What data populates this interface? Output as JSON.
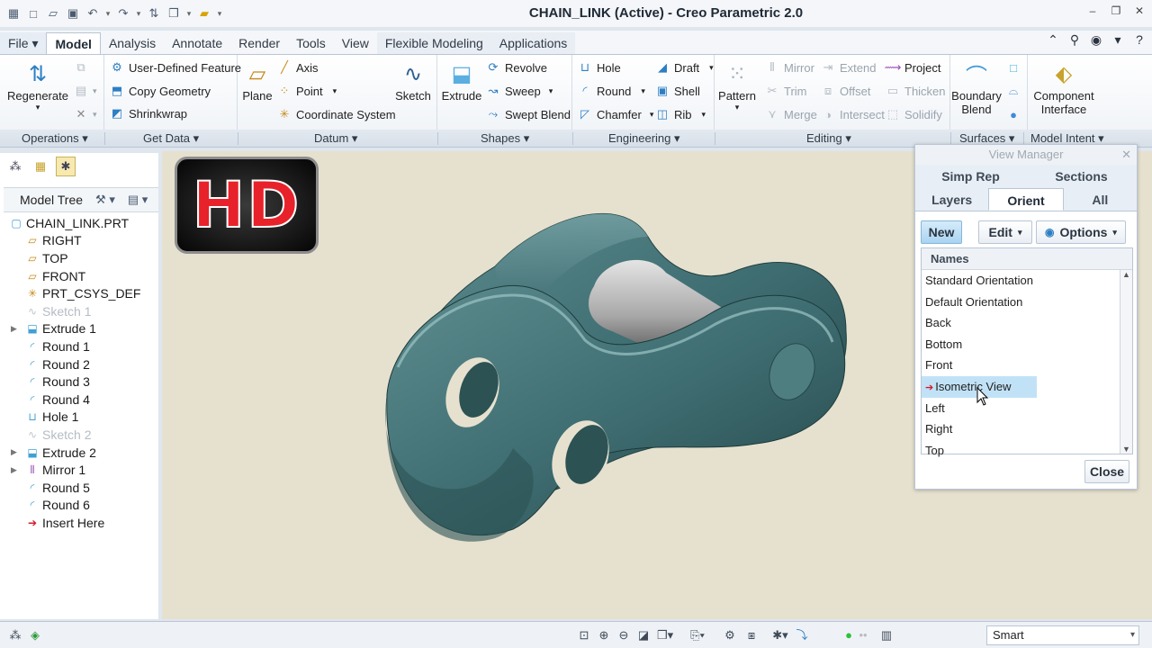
{
  "window": {
    "title": "CHAIN_LINK (Active) - Creo Parametric 2.0"
  },
  "menu": {
    "tabs": [
      "File",
      "Model",
      "Analysis",
      "Annotate",
      "Render",
      "Tools",
      "View",
      "Flexible Modeling",
      "Applications"
    ],
    "active_tab": "Model"
  },
  "ribbon": {
    "operations": {
      "regenerate": "Regenerate"
    },
    "get_data": {
      "user_defined_feature": "User-Defined Feature",
      "copy_geometry": "Copy Geometry",
      "shrinkwrap": "Shrinkwrap"
    },
    "datum": {
      "plane": "Plane",
      "axis": "Axis",
      "point": "Point",
      "coordinate_system": "Coordinate System",
      "sketch": "Sketch"
    },
    "shapes": {
      "extrude": "Extrude",
      "revolve": "Revolve",
      "sweep": "Sweep",
      "swept_blend": "Swept Blend"
    },
    "engineering": {
      "hole": "Hole",
      "round": "Round",
      "chamfer": "Chamfer",
      "draft": "Draft",
      "shell": "Shell",
      "rib": "Rib"
    },
    "editing": {
      "pattern": "Pattern",
      "mirror": "Mirror",
      "trim": "Trim",
      "merge": "Merge",
      "extend": "Extend",
      "offset": "Offset",
      "intersect": "Intersect",
      "project": "Project",
      "thicken": "Thicken",
      "solidify": "Solidify"
    },
    "surfaces": {
      "boundary_blend_line1": "Boundary",
      "boundary_blend_line2": "Blend"
    },
    "model_intent": {
      "component_interface_line1": "Component",
      "component_interface_line2": "Interface"
    }
  },
  "group_labels": {
    "operations": "Operations ▾",
    "get_data": "Get Data ▾",
    "datum": "Datum ▾",
    "shapes": "Shapes ▾",
    "engineering": "Engineering ▾",
    "editing": "Editing ▾",
    "surfaces": "Surfaces ▾",
    "model_intent": "Model Intent ▾"
  },
  "model_tree": {
    "header": "Model Tree",
    "items": [
      {
        "label": "CHAIN_LINK.PRT",
        "icon": "part-icon"
      },
      {
        "label": "RIGHT",
        "icon": "datum-plane-icon"
      },
      {
        "label": "TOP",
        "icon": "datum-plane-icon"
      },
      {
        "label": "FRONT",
        "icon": "datum-plane-icon"
      },
      {
        "label": "PRT_CSYS_DEF",
        "icon": "csys-icon"
      },
      {
        "label": "Sketch 1",
        "icon": "sketch-icon"
      },
      {
        "label": "Extrude 1",
        "icon": "extrude-icon"
      },
      {
        "label": "Round 1",
        "icon": "round-icon"
      },
      {
        "label": "Round 2",
        "icon": "round-icon"
      },
      {
        "label": "Round 3",
        "icon": "round-icon"
      },
      {
        "label": "Round 4",
        "icon": "round-icon"
      },
      {
        "label": "Hole 1",
        "icon": "hole-icon"
      },
      {
        "label": "Sketch 2",
        "icon": "sketch-icon"
      },
      {
        "label": "Extrude 2",
        "icon": "extrude-icon"
      },
      {
        "label": "Mirror 1",
        "icon": "mirror-icon"
      },
      {
        "label": "Round 5",
        "icon": "round-icon"
      },
      {
        "label": "Round 6",
        "icon": "round-icon"
      },
      {
        "label": "Insert Here",
        "icon": "insert-arrow-icon"
      }
    ]
  },
  "badge": {
    "text": "HD"
  },
  "view_manager": {
    "title": "View Manager",
    "tabs_row1": [
      "Simp Rep",
      "Sections"
    ],
    "tabs_row2": [
      "Layers",
      "Orient",
      "All"
    ],
    "active_tab": "Orient",
    "buttons": {
      "new": "New",
      "edit": "Edit",
      "options": "Options"
    },
    "list_header": "Names",
    "orientations": [
      "Standard Orientation",
      "Default Orientation",
      "Back",
      "Bottom",
      "Front",
      "Isometric View",
      "Left",
      "Right",
      "Top"
    ],
    "selected": "Isometric View",
    "close": "Close"
  },
  "status": {
    "filter_value": "Smart"
  },
  "colors": {
    "model_body": "#3f6e72",
    "pin": "#a8a8a8",
    "viewport_bg": "#e6e1cf",
    "accent_selection": "#c1e2f6",
    "badge_red": "#e8222a"
  }
}
